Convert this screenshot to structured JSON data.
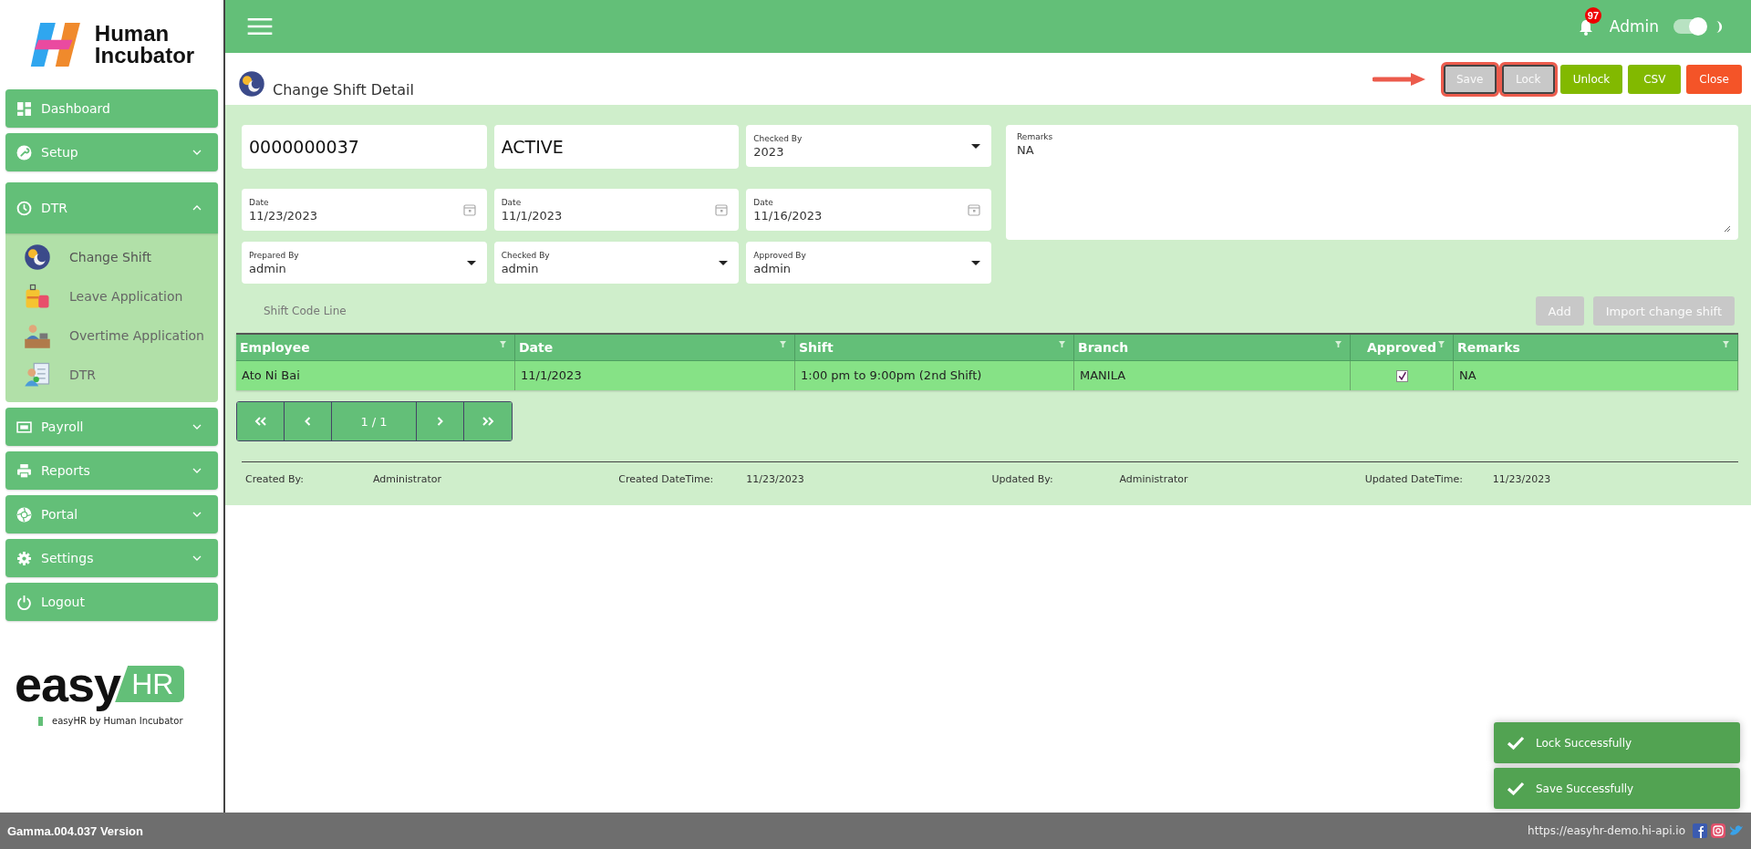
{
  "brand": {
    "line1": "Human",
    "line2": "Incubator"
  },
  "header": {
    "notifications": "97",
    "user": "Admin",
    "theme_toggle_on": true
  },
  "sidebar": {
    "items": [
      {
        "label": "Dashboard",
        "kind": "link"
      },
      {
        "label": "Setup",
        "kind": "group",
        "expanded": false
      },
      {
        "label": "DTR",
        "kind": "group",
        "expanded": true,
        "children": [
          {
            "label": "Change Shift",
            "selected": true
          },
          {
            "label": "Leave Application",
            "selected": false
          },
          {
            "label": "Overtime Application",
            "selected": false
          },
          {
            "label": "DTR",
            "selected": false
          }
        ]
      },
      {
        "label": "Payroll",
        "kind": "group",
        "expanded": false
      },
      {
        "label": "Reports",
        "kind": "group",
        "expanded": false
      },
      {
        "label": "Portal",
        "kind": "group",
        "expanded": false
      },
      {
        "label": "Settings",
        "kind": "group",
        "expanded": false
      },
      {
        "label": "Logout",
        "kind": "link"
      }
    ]
  },
  "product_logo": {
    "word": "easy",
    "badge": "HR",
    "tagline": "easyHR by Human Incubator"
  },
  "page": {
    "title": "Change Shift Detail",
    "actions": [
      {
        "label": "Save",
        "kind": "neutral",
        "disabled": true,
        "highlighted": true
      },
      {
        "label": "Lock",
        "kind": "neutral",
        "disabled": true,
        "highlighted": true
      },
      {
        "label": "Unlock",
        "kind": "primary",
        "disabled": false,
        "highlighted": false
      },
      {
        "label": "CSV",
        "kind": "primary",
        "disabled": false,
        "highlighted": false
      },
      {
        "label": "Close",
        "kind": "danger",
        "disabled": false,
        "highlighted": false
      }
    ]
  },
  "form": {
    "document_no": "0000000037",
    "status": "ACTIVE",
    "fields": [
      {
        "label": "Checked By",
        "value": "2023",
        "kind": "select"
      },
      {
        "label": "Date",
        "value": "11/23/2023",
        "kind": "date"
      },
      {
        "label": "Date",
        "value": "11/1/2023",
        "kind": "date"
      },
      {
        "label": "Date",
        "value": "11/16/2023",
        "kind": "date"
      },
      {
        "label": "Prepared By",
        "value": "admin",
        "kind": "select"
      },
      {
        "label": "Checked By",
        "value": "admin",
        "kind": "select"
      },
      {
        "label": "Approved By",
        "value": "admin",
        "kind": "select"
      }
    ],
    "remarks": {
      "label": "Remarks",
      "value": "NA"
    }
  },
  "lines": {
    "title": "Shift Code Line",
    "buttons": [
      {
        "label": "Add",
        "disabled": true
      },
      {
        "label": "Import change shift",
        "disabled": true
      }
    ],
    "columns": [
      "Employee",
      "Date",
      "Shift",
      "Branch",
      "Approved",
      "Remarks"
    ],
    "rows": [
      {
        "employee": "Ato Ni Bai",
        "date": "11/1/2023",
        "shift": "1:00 pm to 9:00pm (2nd Shift)",
        "branch": "MANILA",
        "approved": true,
        "remarks": "NA"
      }
    ],
    "pager": "1 / 1"
  },
  "audit": [
    {
      "label": "Created By:",
      "value": "Administrator"
    },
    {
      "label": "Created DateTime:",
      "value": "11/23/2023"
    },
    {
      "label": "Updated By:",
      "value": "Administrator"
    },
    {
      "label": "Updated DateTime:",
      "value": "11/23/2023"
    }
  ],
  "toasts": [
    "Lock Successfully",
    "Save Successfully"
  ],
  "status_bar": {
    "version": "Gamma.004.037 Version",
    "url": "https://easyhr-demo.hi-api.io"
  }
}
